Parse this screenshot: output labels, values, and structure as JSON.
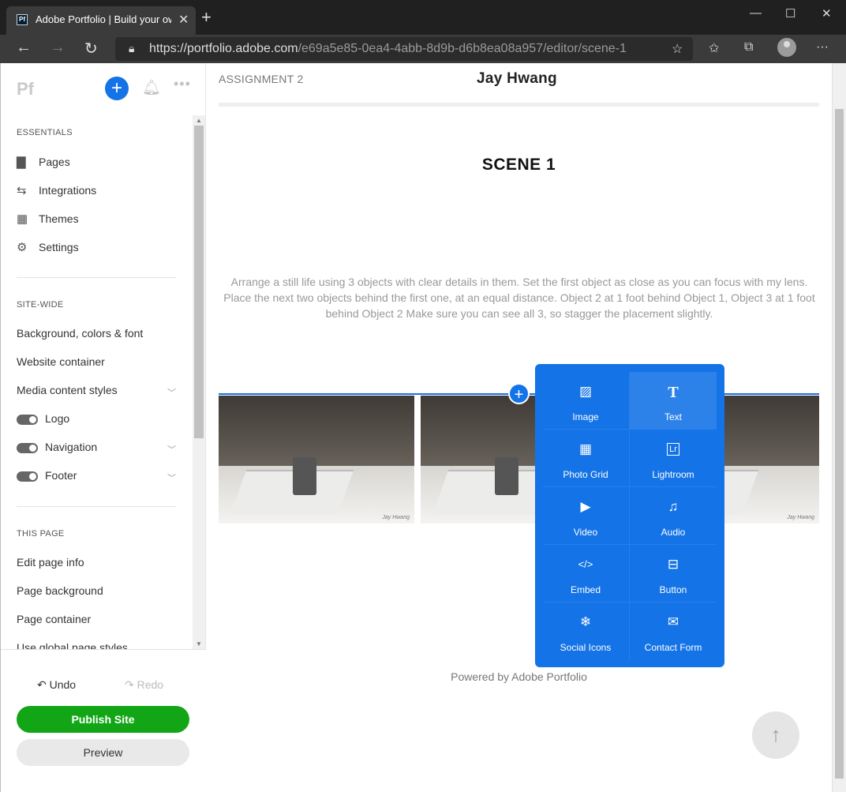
{
  "browser": {
    "tab_title": "Adobe Portfolio | Build your own",
    "tab_favicon": "Pf",
    "url_host": "https://portfolio.adobe.com",
    "url_path": "/e69a5e85-0ea4-4abb-8d9b-d6b8ea08a957/editor/scene-1"
  },
  "sidebar": {
    "logo": "Pf",
    "essentials_label": "ESSENTIALS",
    "essentials": [
      {
        "label": "Pages",
        "icon": "page-icon"
      },
      {
        "label": "Integrations",
        "icon": "integrations-icon"
      },
      {
        "label": "Themes",
        "icon": "themes-icon"
      },
      {
        "label": "Settings",
        "icon": "gear-icon"
      }
    ],
    "sitewide_label": "SITE-WIDE",
    "sitewide": [
      {
        "label": "Background, colors & font"
      },
      {
        "label": "Website container"
      },
      {
        "label": "Media content styles"
      },
      {
        "label": "Logo"
      },
      {
        "label": "Navigation"
      },
      {
        "label": "Footer"
      }
    ],
    "thispage_label": "THIS PAGE",
    "thispage": [
      {
        "label": "Edit page info"
      },
      {
        "label": "Page background"
      },
      {
        "label": "Page container"
      },
      {
        "label": "Use global page styles"
      }
    ],
    "undo_label": "Undo",
    "redo_label": "Redo",
    "publish_label": "Publish Site",
    "preview_label": "Preview"
  },
  "content": {
    "assignment": "ASSIGNMENT 2",
    "site_name": "Jay Hwang",
    "scene_title": "SCENE 1",
    "description": "Arrange a still life using 3 objects with clear details in them. Set the first object as close as you can focus with my lens. Place the next two objects behind the first one, at an equal distance. Object 2 at 1 foot behind Object 1, Object 3 at 1 foot behind Object 2 Make sure you can see all 3, so stagger the placement slightly.",
    "photo_watermark": "Jay Hwang",
    "powered_by": "Powered by Adobe Portfolio"
  },
  "add_menu": {
    "items": [
      {
        "label": "Image",
        "icon": "image-icon"
      },
      {
        "label": "Text",
        "icon": "text-icon"
      },
      {
        "label": "Photo Grid",
        "icon": "photo-grid-icon"
      },
      {
        "label": "Lightroom",
        "icon": "lightroom-icon"
      },
      {
        "label": "Video",
        "icon": "video-icon"
      },
      {
        "label": "Audio",
        "icon": "audio-icon"
      },
      {
        "label": "Embed",
        "icon": "embed-icon"
      },
      {
        "label": "Button",
        "icon": "button-icon"
      },
      {
        "label": "Social Icons",
        "icon": "social-icons-icon"
      },
      {
        "label": "Contact Form",
        "icon": "mail-icon"
      }
    ]
  },
  "colors": {
    "accent": "#1473e6",
    "publish": "#12a617"
  }
}
